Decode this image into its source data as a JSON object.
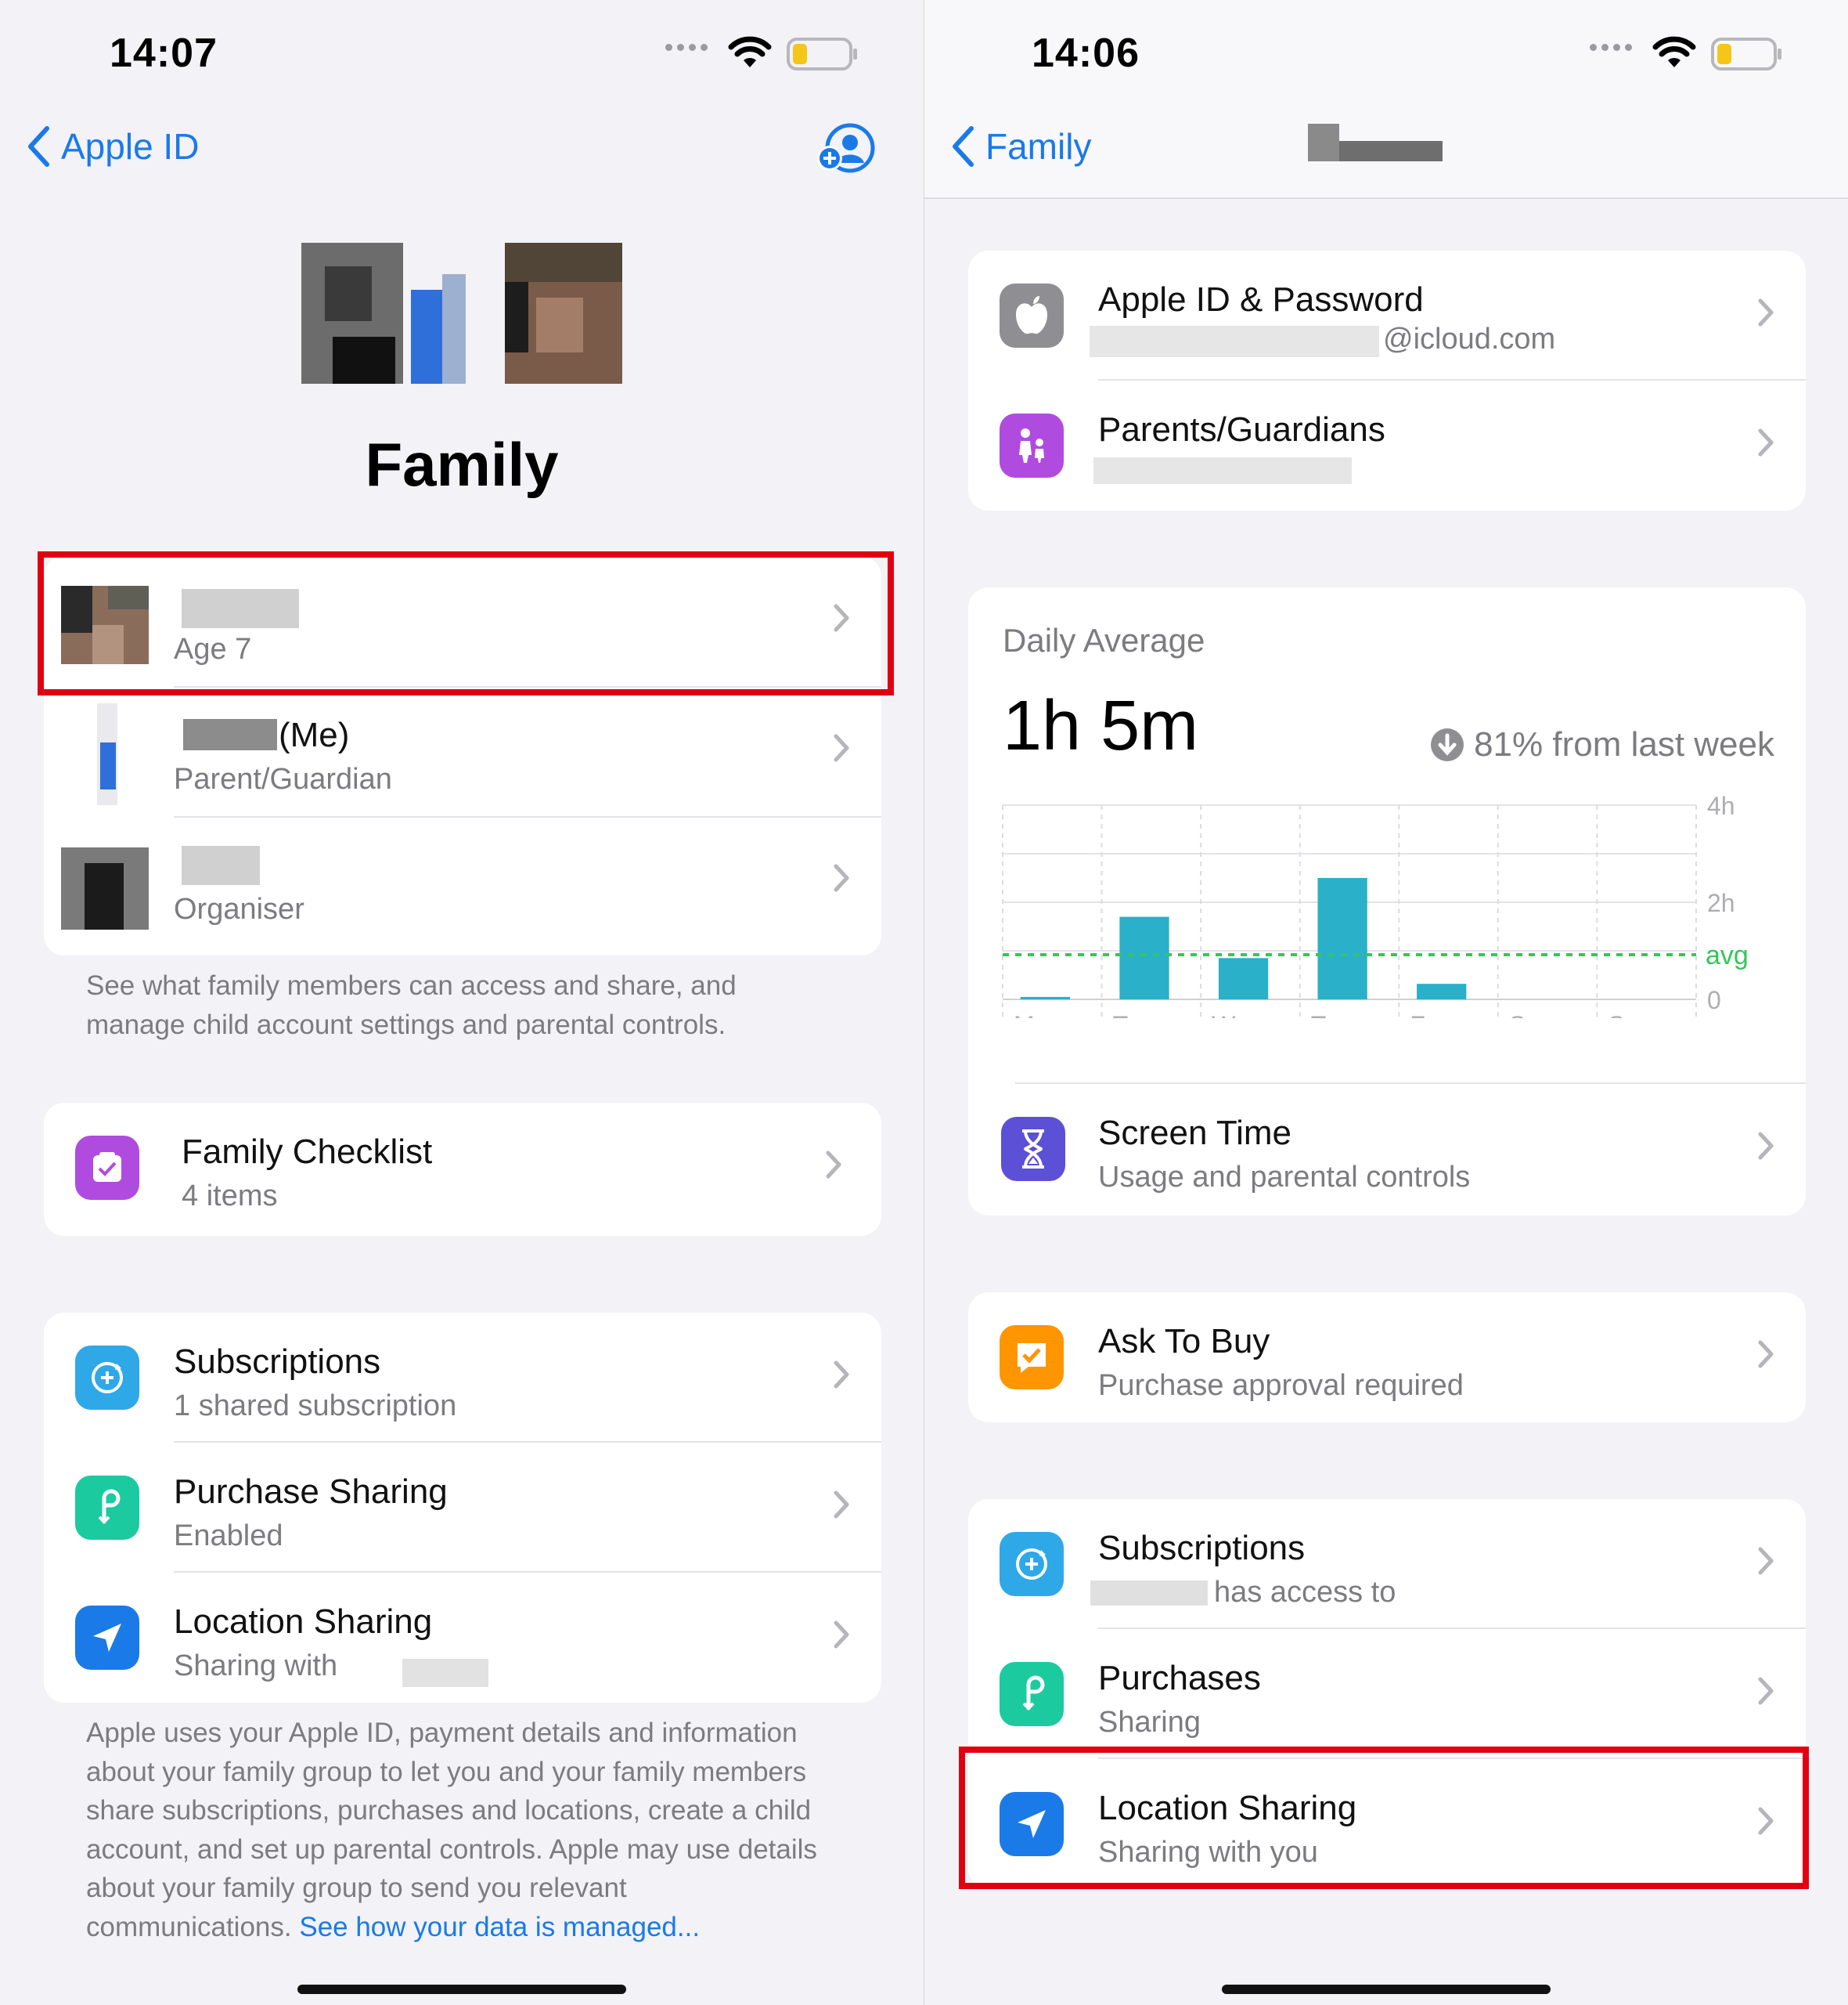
{
  "left": {
    "status": {
      "time": "14:07"
    },
    "nav": {
      "back_label": "Apple ID"
    },
    "title": "Family",
    "members": [
      {
        "sub": "Age 7"
      },
      {
        "name_suffix": "(Me)",
        "sub": "Parent/Guardian"
      },
      {
        "sub": "Organiser"
      }
    ],
    "members_footnote": "See what family members can access and share, and manage child account settings and parental controls.",
    "checklist": {
      "title": "Family Checklist",
      "sub": "4 items"
    },
    "features": [
      {
        "title": "Subscriptions",
        "sub": "1 shared subscription",
        "icon": "subscriptions-icon"
      },
      {
        "title": "Purchase Sharing",
        "sub": "Enabled",
        "icon": "purchase-sharing-icon"
      },
      {
        "title": "Location Sharing",
        "sub": "Sharing with",
        "icon": "location-arrow-icon"
      }
    ],
    "footer_text": "Apple uses your Apple ID, payment details and information about your family group to let you and your family members share subscriptions, purchases and locations, create a child account, and set up parental controls. Apple may use details about your family group to send you relevant communications.",
    "footer_link": "See how your data is managed..."
  },
  "right": {
    "status": {
      "time": "14:06"
    },
    "nav": {
      "back_label": "Family"
    },
    "account_rows": [
      {
        "title": "Apple ID & Password",
        "sub": "@icloud.com",
        "icon": "apple-logo-icon"
      },
      {
        "title": "Parents/Guardians",
        "sub": "",
        "icon": "parent-child-icon"
      }
    ],
    "usage": {
      "label": "Daily Average",
      "value": "1h 5m",
      "trend": "81% from last week",
      "screen_time_title": "Screen Time",
      "screen_time_sub": "Usage and parental controls"
    },
    "ask_to_buy": {
      "title": "Ask To Buy",
      "sub": "Purchase approval required"
    },
    "sharing_rows": [
      {
        "title": "Subscriptions",
        "sub": "has access to",
        "icon": "subscriptions-icon"
      },
      {
        "title": "Purchases",
        "sub": "Sharing",
        "icon": "purchase-sharing-icon"
      },
      {
        "title": "Location Sharing",
        "sub": "Sharing with you",
        "icon": "location-arrow-icon"
      }
    ]
  },
  "chart_data": {
    "type": "bar",
    "categories": [
      "M",
      "T",
      "W",
      "T",
      "F",
      "S",
      "S"
    ],
    "values": [
      0.05,
      1.7,
      0.85,
      2.5,
      0.32,
      0,
      0
    ],
    "y_ticks": [
      "4h",
      "2h",
      "0"
    ],
    "ylim": [
      0,
      4
    ],
    "average_label": "avg",
    "average_value": 0.92,
    "bar_color": "#2ab0c8",
    "avg_color": "#34c759"
  },
  "colors": {
    "accent": "#1a7ae8",
    "highlight": "#e00012"
  }
}
